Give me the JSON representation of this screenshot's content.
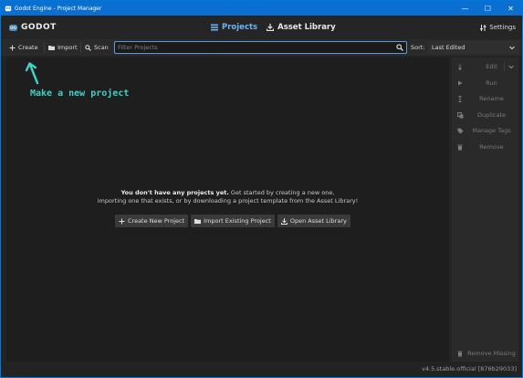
{
  "window": {
    "title": "Godot Engine - Project Manager",
    "min_glyph": "—",
    "max_glyph": "☐",
    "close_glyph": "✕"
  },
  "header": {
    "logo_text": "GODOT",
    "tabs": [
      {
        "label": "Projects",
        "icon": "projects-list-icon",
        "active": true
      },
      {
        "label": "Asset Library",
        "icon": "asset-library-icon",
        "active": false
      }
    ],
    "settings_label": "Settings"
  },
  "toolbar": {
    "create_label": "Create",
    "import_label": "Import",
    "scan_label": "Scan",
    "filter_placeholder": "Filter Projects",
    "filter_value": "",
    "sort_label": "Sort:",
    "sort_value": "Last Edited"
  },
  "main": {
    "hint": "Make a new project",
    "empty_bold": "You don't have any projects yet.",
    "empty_rest": " Get started by creating a new one,",
    "empty_line2": "importing one that exists, or by downloading a project template from the Asset Library!",
    "actions": [
      {
        "label": "Create New Project",
        "icon": "plus-icon"
      },
      {
        "label": "Import Existing Project",
        "icon": "folder-icon"
      },
      {
        "label": "Open Asset Library",
        "icon": "download-icon"
      }
    ]
  },
  "side": {
    "edit": "Edit",
    "run": "Run",
    "rename": "Rename",
    "duplicate": "Duplicate",
    "manage_tags": "Manage Tags",
    "remove": "Remove",
    "remove_missing": "Remove Missing"
  },
  "footer": {
    "version": "v4.5.stable.official [876b29033]"
  },
  "colors": {
    "accent": "#6cb1f2",
    "titlebar": "#0a6fd1",
    "hint": "#43d0c6",
    "background": "#1e1e1e"
  }
}
